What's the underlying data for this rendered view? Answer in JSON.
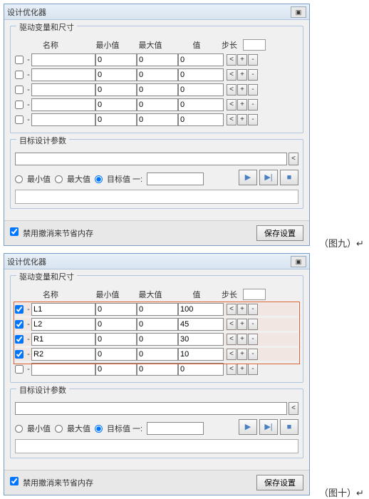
{
  "dialog_title": "设计优化器",
  "close_glyph": "▣",
  "group1": {
    "legend": "驱动变量和尺寸",
    "headers": {
      "name": "名称",
      "min": "最小值",
      "max": "最大值",
      "val": "值",
      "step": "步长"
    }
  },
  "rows_blank": [
    {
      "cb": false,
      "name": "",
      "min": "0",
      "max": "0",
      "val": "0"
    },
    {
      "cb": false,
      "name": "",
      "min": "0",
      "max": "0",
      "val": "0"
    },
    {
      "cb": false,
      "name": "",
      "min": "0",
      "max": "0",
      "val": "0"
    },
    {
      "cb": false,
      "name": "",
      "min": "0",
      "max": "0",
      "val": "0"
    },
    {
      "cb": false,
      "name": "",
      "min": "0",
      "max": "0",
      "val": "0"
    }
  ],
  "rows_filled": [
    {
      "cb": true,
      "name": "L1",
      "min": "0",
      "max": "0",
      "val": "100"
    },
    {
      "cb": true,
      "name": "L2",
      "min": "0",
      "max": "0",
      "val": "45"
    },
    {
      "cb": true,
      "name": "R1",
      "min": "0",
      "max": "0",
      "val": "30"
    },
    {
      "cb": true,
      "name": "R2",
      "min": "0",
      "max": "0",
      "val": "10"
    },
    {
      "cb": false,
      "name": "",
      "min": "0",
      "max": "0",
      "val": "0"
    }
  ],
  "btns": {
    "lt": "<",
    "plus": "+",
    "minus": "-"
  },
  "group2": {
    "legend": "目标设计参数"
  },
  "radios": {
    "min": "最小值",
    "max": "最大值",
    "target": "目标值 一:"
  },
  "arrow": "<",
  "play": {
    "p1": "▶",
    "p2": "▶|",
    "p3": "■"
  },
  "footer": {
    "cb": "禁用撤消来节省内存",
    "save": "保存设置"
  },
  "captions": {
    "c1": "（图九）",
    "c2": "（图十）",
    "ret": "↵"
  }
}
